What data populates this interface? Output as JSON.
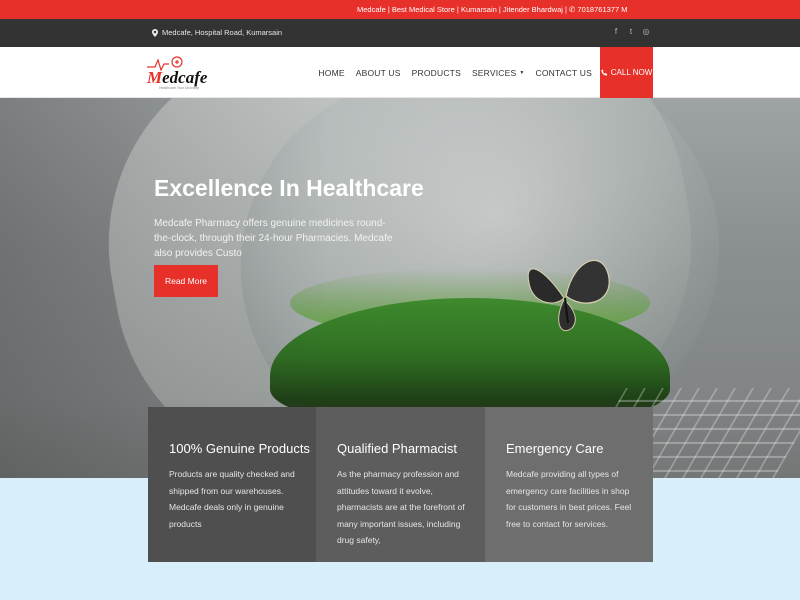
{
  "topbar": {
    "ticker": "Medcafe | Best Medical Store | Kumarsain | Jitender Bhardwaj | ✆ 7018761377    M",
    "bg": "#e8302a"
  },
  "infobar": {
    "address": "Medcafe, Hospital Road, Kumarsain",
    "social": [
      {
        "icon": "facebook-icon",
        "glyph": "f"
      },
      {
        "icon": "twitter-icon",
        "glyph": "t"
      },
      {
        "icon": "instagram-icon",
        "glyph": "◎"
      }
    ]
  },
  "header": {
    "logo_text_m": "M",
    "logo_text_rest": "edcafe",
    "logo_tagline": "Healthcare Your Doorstep",
    "nav": {
      "home": "HOME",
      "about": "ABOUT US",
      "products": "PRODUCTS",
      "services": "SERVICES",
      "contact": "CONTACT US",
      "call": "CALL NOW"
    },
    "accent": "#e8302a"
  },
  "hero": {
    "title": "Excellence In Healthcare",
    "description": "Medcafe Pharmacy offers genuine medicines round-the-clock, through their 24-hour Pharmacies. Medcafe also provides Custo",
    "button": "Read More"
  },
  "features": [
    {
      "title": "100% Genuine Products",
      "text": "Products are quality checked and shipped from our warehouses. Medcafe deals only in genuine products"
    },
    {
      "title": "Qualified Pharmacist",
      "text": "As the pharmacy profession and attitudes toward it evolve, pharmacists are at the forefront of many important issues, including drug safety,"
    },
    {
      "title": "Emergency Care",
      "text": "Medcafe providing all types of emergency care facilities in shop for customers in best prices. Feel free to contact for services."
    }
  ]
}
